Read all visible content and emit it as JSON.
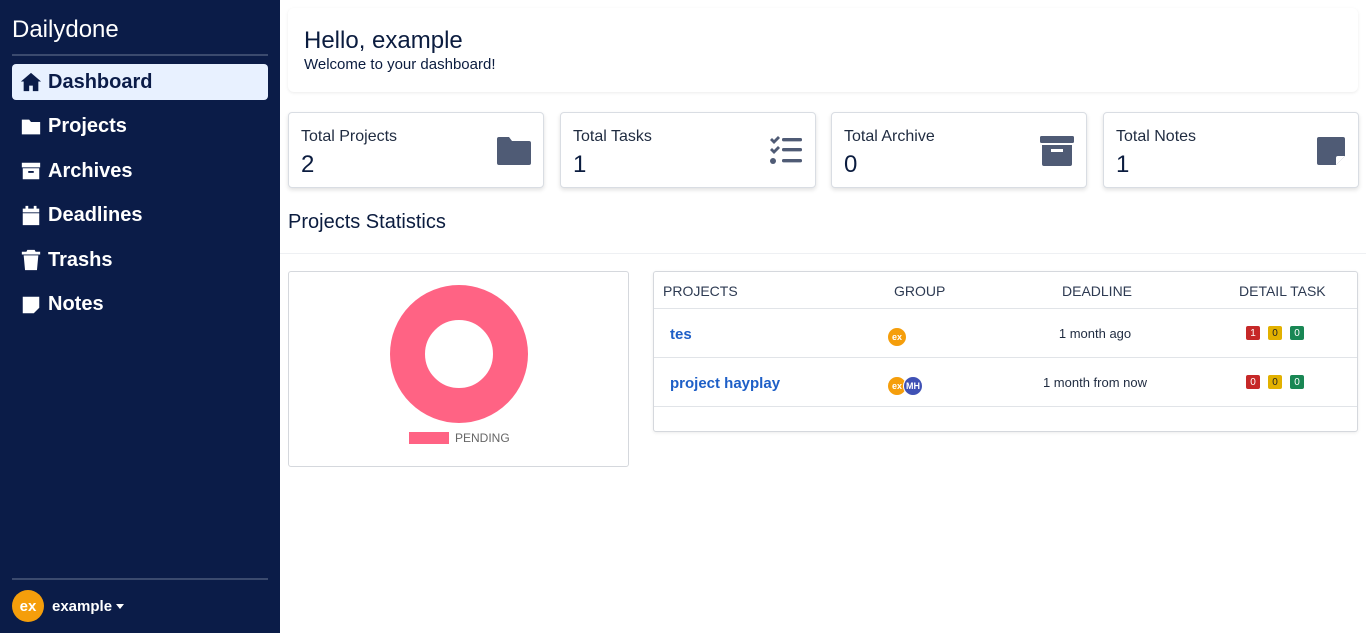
{
  "app": {
    "brand": "Dailydone"
  },
  "sidebar": {
    "items": [
      {
        "label": "Dashboard",
        "icon": "home-icon",
        "active": true
      },
      {
        "label": "Projects",
        "icon": "folder-icon"
      },
      {
        "label": "Archives",
        "icon": "archive-icon"
      },
      {
        "label": "Deadlines",
        "icon": "calendar-icon"
      },
      {
        "label": "Trashs",
        "icon": "trash-icon"
      },
      {
        "label": "Notes",
        "icon": "note-icon"
      }
    ],
    "user": {
      "initials": "ex",
      "name": "example"
    }
  },
  "header": {
    "title": "Hello, example",
    "subtitle": "Welcome to your dashboard!"
  },
  "stats": [
    {
      "label": "Total Projects",
      "value": "2",
      "icon": "folder-icon"
    },
    {
      "label": "Total Tasks",
      "value": "1",
      "icon": "task-list-icon"
    },
    {
      "label": "Total Archive",
      "value": "0",
      "icon": "archive-box-icon"
    },
    {
      "label": "Total Notes",
      "value": "1",
      "icon": "sticky-note-icon"
    }
  ],
  "section": {
    "title": "Projects Statistics"
  },
  "chart_data": {
    "type": "pie",
    "labels": [
      "PENDING"
    ],
    "values": [
      1
    ],
    "colors": [
      "#ff6384"
    ],
    "legend": "bottom"
  },
  "table": {
    "headers": [
      "PROJECTS",
      "GROUP",
      "DEADLINE",
      "DETAIL TASK"
    ],
    "rows": [
      {
        "project": "tes",
        "group": [
          "ex"
        ],
        "deadline": "1 month ago",
        "tasks": [
          "1",
          "0",
          "0"
        ]
      },
      {
        "project": "project hayplay",
        "group": [
          "ex",
          "MH"
        ],
        "deadline": "1 month from now",
        "tasks": [
          "0",
          "0",
          "0"
        ]
      }
    ]
  },
  "colors": {
    "sidebar": "#0b1c48",
    "accent": "#1e5fc7",
    "avatar": "#f59e0b"
  }
}
